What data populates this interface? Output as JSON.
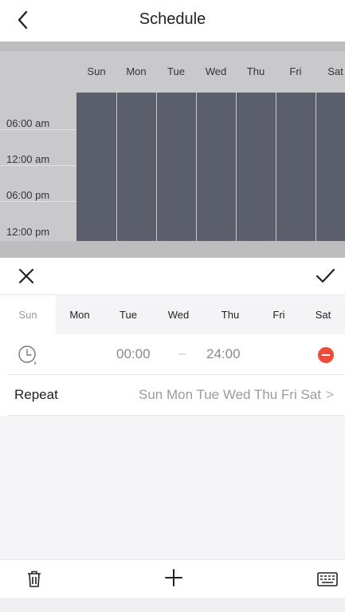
{
  "header": {
    "title": "Schedule",
    "back_icon": "chevron-left-icon"
  },
  "grid": {
    "days": [
      "Sun",
      "Mon",
      "Tue",
      "Wed",
      "Thu",
      "Fri",
      "Sat"
    ],
    "times": [
      "06:00 am",
      "12:00 am",
      "06:00 pm",
      "12:00 pm"
    ],
    "fill_color": "#5b5f6c"
  },
  "editor": {
    "cancel_icon": "close-icon",
    "confirm_icon": "checkmark-icon",
    "tabs": [
      "Sun",
      "Mon",
      "Tue",
      "Wed",
      "Thu",
      "Fri",
      "Sat"
    ],
    "active_tab": "Sun",
    "time_row": {
      "icon": "clock-icon",
      "start": "00:00",
      "separator": "–",
      "end": "24:00",
      "remove_icon": "remove-icon",
      "remove_color": "#ef4a3a"
    },
    "repeat": {
      "label": "Repeat",
      "value": "Sun Mon Tue Wed Thu Fri Sat",
      "chevron": ">"
    }
  },
  "footer": {
    "delete_icon": "trash-icon",
    "add_icon": "plus-icon",
    "keyboard_icon": "keyboard-icon"
  }
}
